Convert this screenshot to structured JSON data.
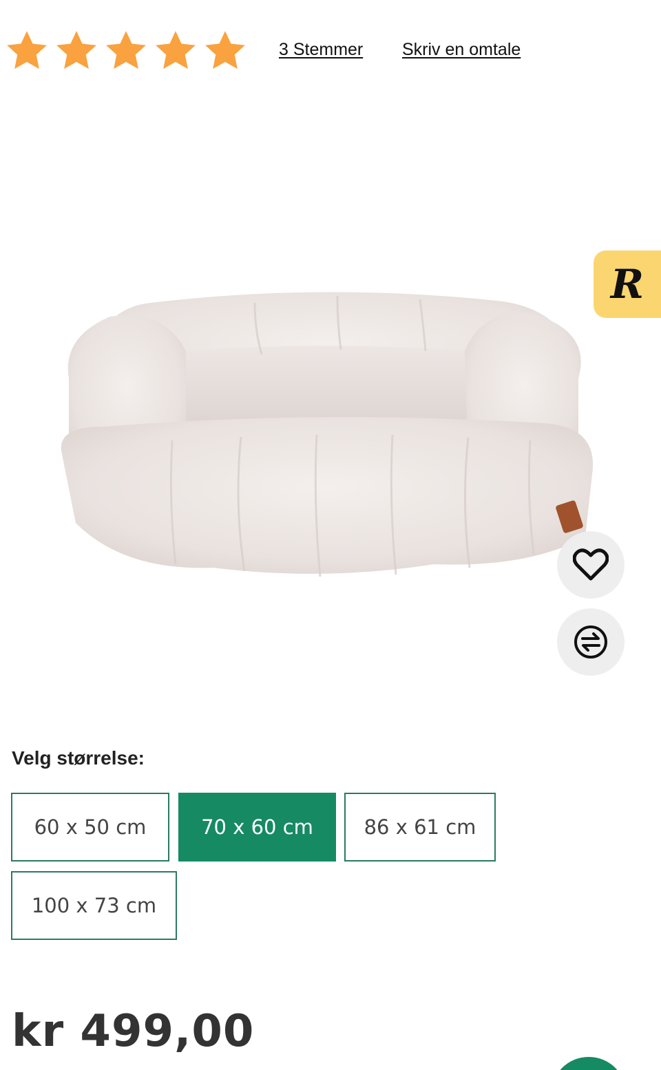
{
  "rating": {
    "stars_filled": 5,
    "stars_total": 5,
    "star_color": "#f9a23f",
    "votes_link": "3 Stemmer",
    "review_link": "Skriv en omtale"
  },
  "product": {
    "image": "plush-dog-bed-photo"
  },
  "badge": {
    "letter": "R",
    "color": "#fbd56f"
  },
  "actions": {
    "favorite_icon": "heart-icon",
    "compare_icon": "compare-arrows-icon"
  },
  "size_selector": {
    "label": "Velg størrelse:",
    "options": [
      {
        "label": "60 x 50 cm",
        "selected": false
      },
      {
        "label": "70 x 60 cm",
        "selected": true
      },
      {
        "label": "86 x 61 cm",
        "selected": false
      },
      {
        "label": "100 x 73 cm",
        "selected": false
      }
    ],
    "accent_color": "#168a62"
  },
  "price": {
    "display": "kr 499,00"
  }
}
